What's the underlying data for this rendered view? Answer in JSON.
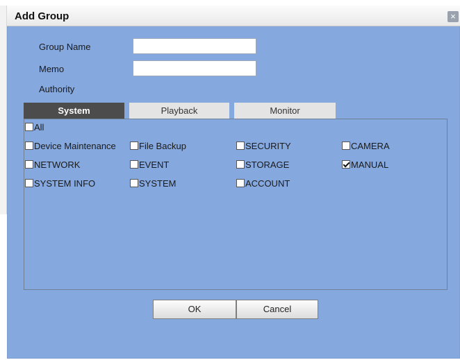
{
  "dialog": {
    "title": "Add Group",
    "close_symbol": "×"
  },
  "form": {
    "group_name_label": "Group Name",
    "group_name_value": "",
    "memo_label": "Memo",
    "memo_value": "",
    "authority_label": "Authority"
  },
  "tabs": [
    {
      "label": "System",
      "active": true
    },
    {
      "label": "Playback",
      "active": false
    },
    {
      "label": "Monitor",
      "active": false
    }
  ],
  "permissions": {
    "all": {
      "label": "All",
      "checked": false
    },
    "items": [
      {
        "label": "Device Maintenance",
        "checked": false
      },
      {
        "label": "File Backup",
        "checked": false
      },
      {
        "label": "SECURITY",
        "checked": false
      },
      {
        "label": "CAMERA",
        "checked": false
      },
      {
        "label": "NETWORK",
        "checked": false
      },
      {
        "label": "EVENT",
        "checked": false
      },
      {
        "label": "STORAGE",
        "checked": false
      },
      {
        "label": "MANUAL",
        "checked": true
      },
      {
        "label": "SYSTEM INFO",
        "checked": false
      },
      {
        "label": "SYSTEM",
        "checked": false
      },
      {
        "label": "ACCOUNT",
        "checked": false
      }
    ]
  },
  "buttons": {
    "ok_label": "OK",
    "cancel_label": "Cancel"
  },
  "colors": {
    "dialog_background": "#85a8df",
    "active_tab": "#4c4c4c",
    "inactive_tab": "#e4e4e4"
  },
  "icons": {
    "close": "close-icon",
    "check": "checkmark-icon"
  }
}
